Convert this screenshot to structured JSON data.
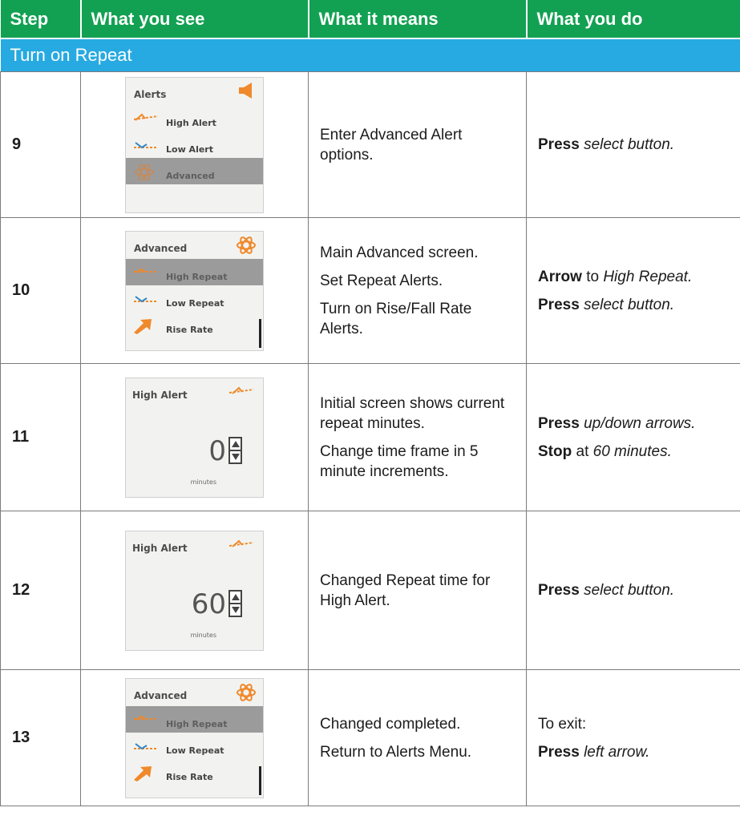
{
  "headers": {
    "step": "Step",
    "see": "What you see",
    "means": "What it means",
    "do": "What you do"
  },
  "section_title": "Turn on Repeat",
  "colors": {
    "header_green": "#12a152",
    "section_blue": "#27aae1",
    "icon_orange": "#f0892b"
  },
  "rows": [
    {
      "step": "9",
      "screen": {
        "title": "Alerts",
        "title_icon": "speaker-icon",
        "items": [
          "High Alert",
          "Low Alert",
          "Advanced"
        ],
        "selected": "Advanced"
      },
      "means": [
        "Enter Advanced Alert options."
      ],
      "do": [
        {
          "bold": "Press",
          "rest": "select button."
        }
      ]
    },
    {
      "step": "10",
      "screen": {
        "title": "Advanced",
        "title_icon": "atom-icon",
        "items": [
          "High Repeat",
          "Low Repeat",
          "Rise Rate"
        ],
        "selected": "High Repeat"
      },
      "means": [
        "Main Advanced screen.",
        "Set Repeat Alerts.",
        "Turn on Rise/Fall Rate Alerts."
      ],
      "do": [
        {
          "bold": "Arrow",
          "plain": "to",
          "rest": "High Repeat."
        },
        {
          "bold": "Press",
          "rest": "select button."
        }
      ]
    },
    {
      "step": "11",
      "screen": {
        "title": "High Alert",
        "value": "0",
        "unit": "minutes"
      },
      "means": [
        "Initial screen shows current repeat minutes.",
        "Change time frame in 5 minute increments."
      ],
      "do": [
        {
          "bold": "Press",
          "rest": "up/down arrows."
        },
        {
          "bold": "Stop",
          "plain": "at",
          "rest": "60 minutes."
        }
      ]
    },
    {
      "step": "12",
      "screen": {
        "title": "High Alert",
        "value": "60",
        "unit": "minutes"
      },
      "means": [
        "Changed Repeat time for High Alert."
      ],
      "do": [
        {
          "bold": "Press",
          "rest": "select button."
        }
      ]
    },
    {
      "step": "13",
      "screen": {
        "title": "Advanced",
        "title_icon": "atom-icon",
        "items": [
          "High Repeat",
          "Low Repeat",
          "Rise Rate"
        ],
        "selected": "High Repeat"
      },
      "means": [
        "Changed completed.",
        "Return to Alerts Menu."
      ],
      "do": [
        {
          "plain": "To exit:"
        },
        {
          "bold": "Press",
          "rest": "left arrow."
        }
      ]
    }
  ]
}
